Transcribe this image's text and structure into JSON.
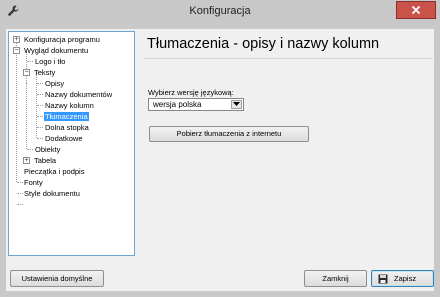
{
  "window": {
    "title": "Konfiguracja"
  },
  "tree": {
    "items": [
      {
        "label": "Konfiguracja programu",
        "selected": false
      },
      {
        "label": "Wygląd dokumentu",
        "selected": false
      },
      {
        "label": "Logo i tło",
        "selected": false
      },
      {
        "label": "Teksty",
        "selected": false
      },
      {
        "label": "Opisy",
        "selected": false
      },
      {
        "label": "Nazwy dokumentów",
        "selected": false
      },
      {
        "label": "Nazwy kolumn",
        "selected": false
      },
      {
        "label": "Tłumaczenia",
        "selected": true
      },
      {
        "label": "Dolna stopka",
        "selected": false
      },
      {
        "label": "Dodatkowe",
        "selected": false
      },
      {
        "label": "Obiekty",
        "selected": false
      },
      {
        "label": "Tabela",
        "selected": false
      },
      {
        "label": "Pieczątka i podpis",
        "selected": false
      },
      {
        "label": "Fonty",
        "selected": false
      },
      {
        "label": "Style dokumentu",
        "selected": false
      }
    ]
  },
  "main": {
    "heading": "Tłumaczenia - opisy i nazwy kolumn",
    "language_label": "Wybierz wersję językową:",
    "language_value": "wersja polska",
    "download_button": "Pobierz tłumaczenia z internetu"
  },
  "footer": {
    "defaults_button": "Ustawienia domyślne",
    "close_button": "Zamknij",
    "save_button": "Zapisz"
  },
  "colors": {
    "selection": "#3399ff",
    "close_button": "#c9524b",
    "tree_border": "#6aa8d0"
  }
}
